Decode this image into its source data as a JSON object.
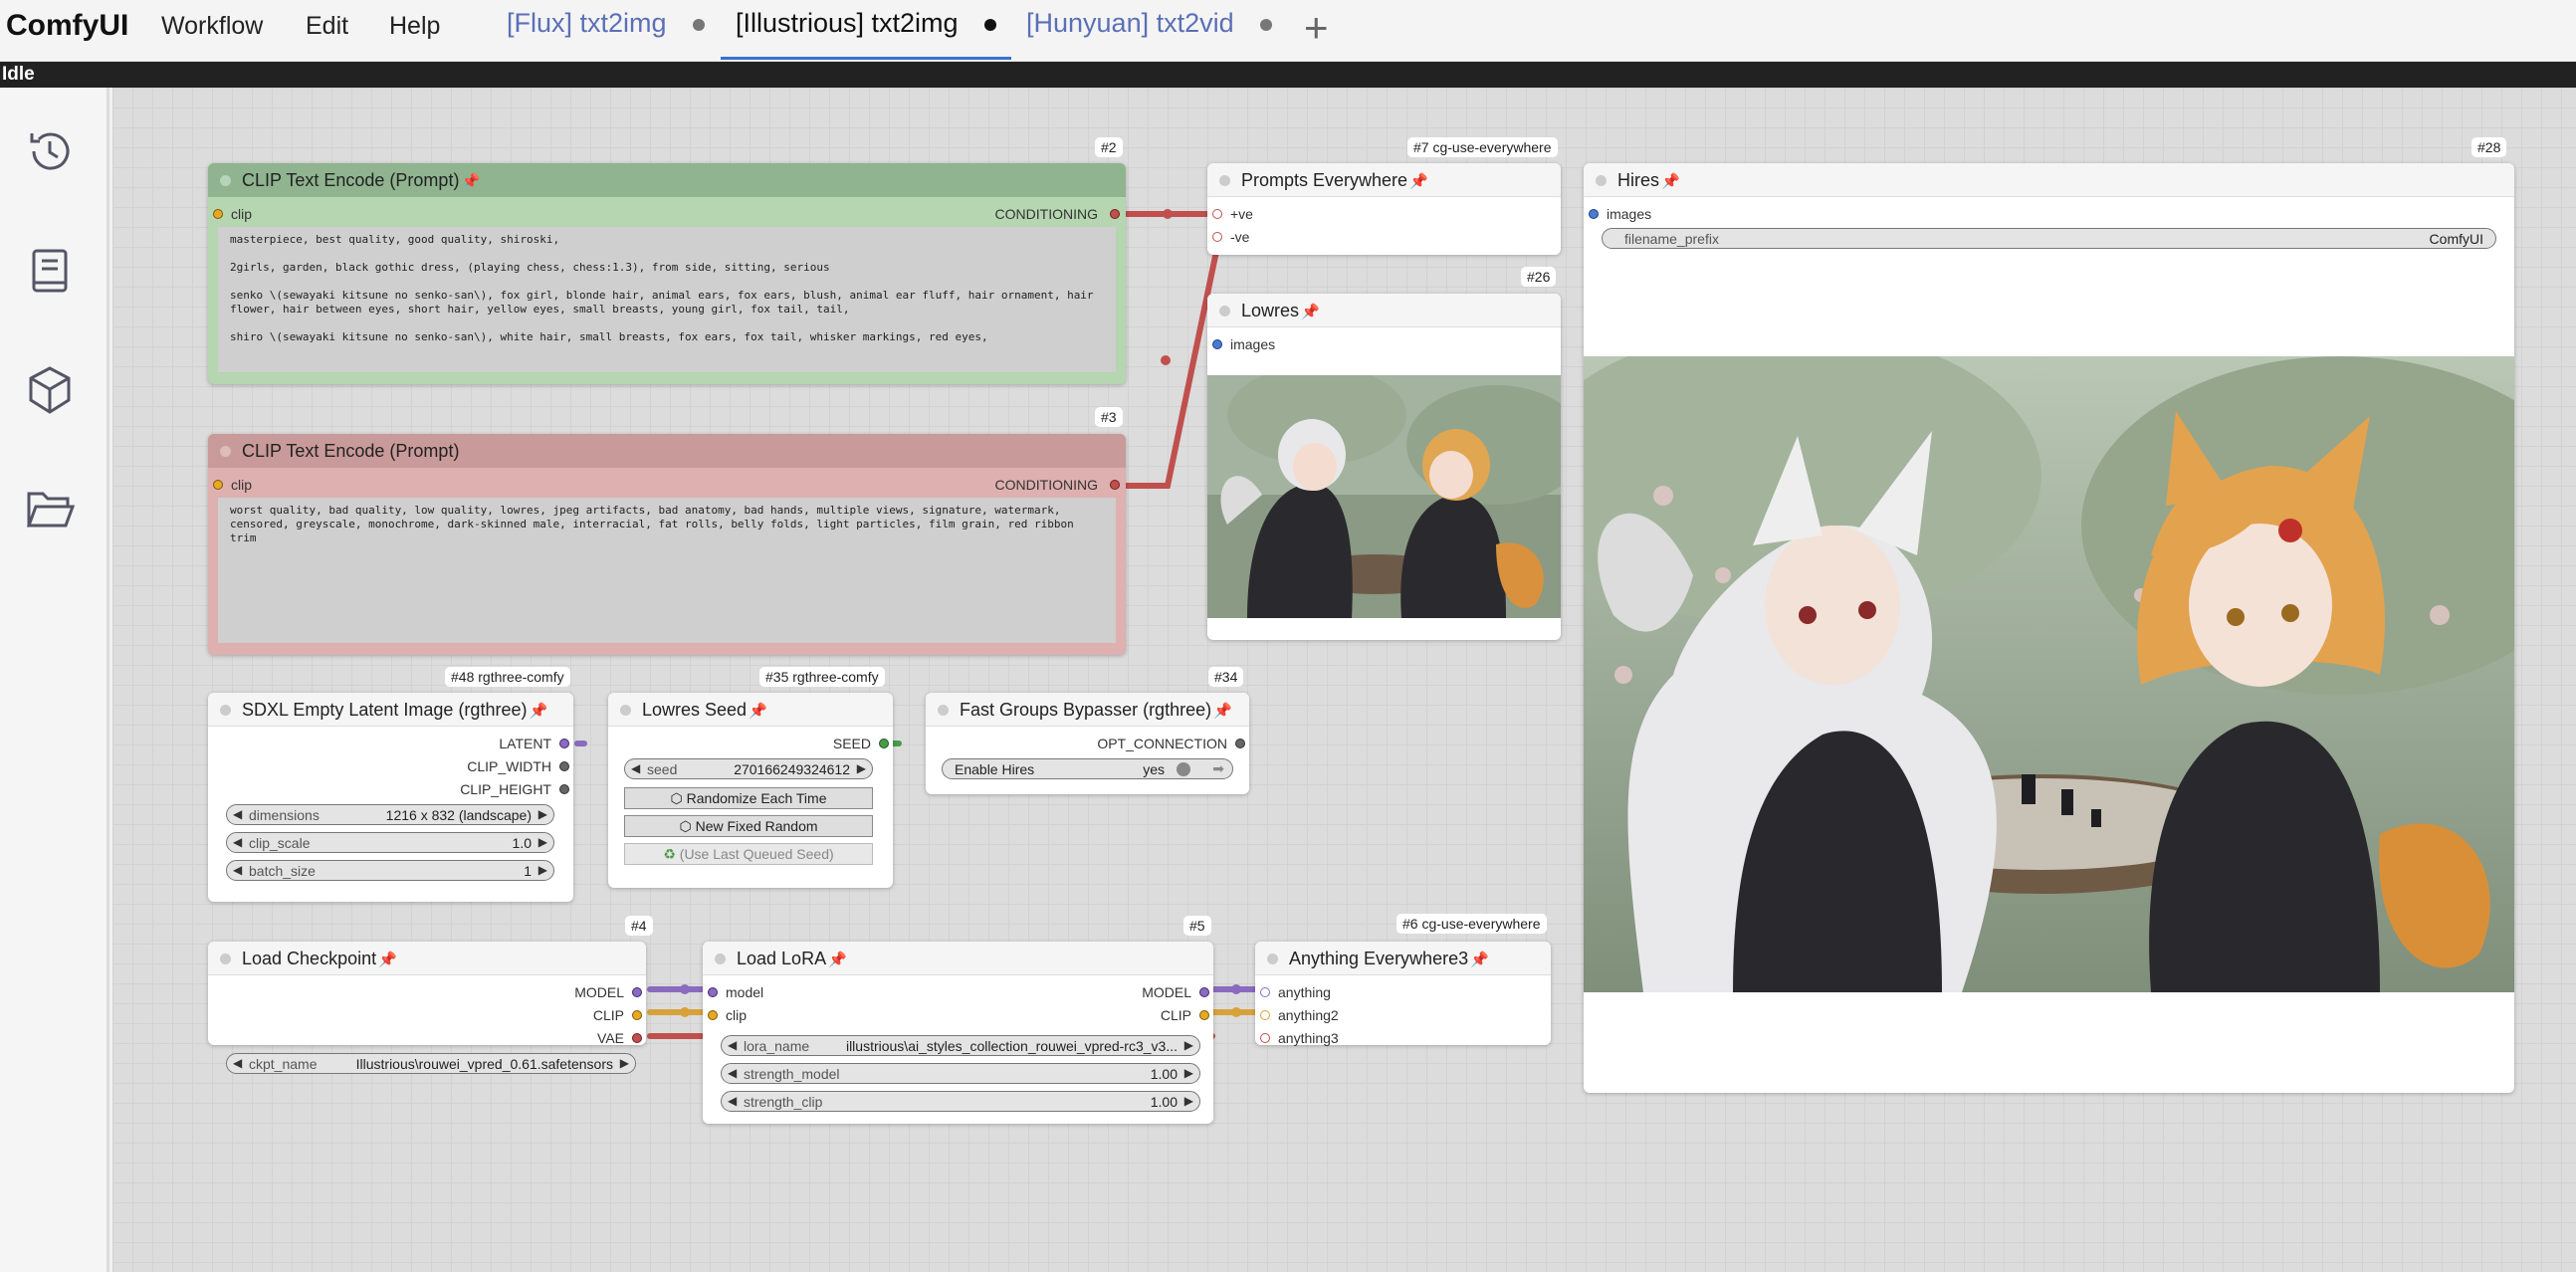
{
  "app": {
    "logo": "ComfyUI",
    "menu": [
      "Workflow",
      "Edit",
      "Help"
    ],
    "tabs": [
      {
        "label": "[Flux] txt2img",
        "active": false
      },
      {
        "label": "[Illustrious] txt2img",
        "active": true
      },
      {
        "label": "[Hunyuan] txt2vid",
        "active": false
      }
    ],
    "add_tab": "+",
    "status": "Idle"
  },
  "sidebar": {
    "icons": [
      "history-icon",
      "book-icon",
      "cube-icon",
      "folder-open-icon"
    ]
  },
  "nodes": {
    "clip_pos": {
      "badge": "#2",
      "title": "CLIP Text Encode (Prompt)",
      "input": "clip",
      "output": "CONDITIONING",
      "text": "masterpiece, best quality, good quality, shiroski,\n\n2girls, garden, black gothic dress, (playing chess, chess:1.3), from side, sitting, serious\n\nsenko \\(sewayaki kitsune no senko-san\\), fox girl, blonde hair, animal ears, fox ears, blush, animal ear fluff, hair ornament, hair flower, hair between eyes, short hair, yellow eyes, small breasts, young girl, fox tail, tail,\n\nshiro \\(sewayaki kitsune no senko-san\\), white hair, small breasts, fox ears, fox tail, whisker markings, red eyes,"
    },
    "clip_neg": {
      "badge": "#3",
      "title": "CLIP Text Encode (Prompt)",
      "input": "clip",
      "output": "CONDITIONING",
      "text": "worst quality, bad quality, low quality, lowres, jpeg artifacts, bad anatomy, bad hands, multiple views, signature, watermark, censored, greyscale, monochrome, dark-skinned male, interracial, fat rolls, belly folds, light particles, film grain, red ribbon trim"
    },
    "prompts_everywhere": {
      "badge": "#7 cg-use-everywhere",
      "title": "Prompts Everywhere",
      "inputs": [
        "+ve",
        "-ve"
      ]
    },
    "lowres": {
      "badge": "#26",
      "title": "Lowres",
      "input": "images"
    },
    "hires": {
      "badge": "#28",
      "title": "Hires",
      "input": "images",
      "widget_label": "filename_prefix",
      "widget_value": "ComfyUI"
    },
    "sdxl_latent": {
      "badge": "#48 rgthree-comfy",
      "title": "SDXL Empty Latent Image (rgthree)",
      "outputs": [
        "LATENT",
        "CLIP_WIDTH",
        "CLIP_HEIGHT"
      ],
      "widgets": [
        {
          "label": "dimensions",
          "value": "1216 x 832   (landscape)"
        },
        {
          "label": "clip_scale",
          "value": "1.0"
        },
        {
          "label": "batch_size",
          "value": "1"
        }
      ]
    },
    "lowres_seed": {
      "badge": "#35 rgthree-comfy",
      "title": "Lowres Seed",
      "output": "SEED",
      "seed_label": "seed",
      "seed_value": "270166249324612",
      "btn_randomize": "Randomize Each Time",
      "btn_fixed": "New Fixed Random",
      "btn_last": "(Use Last Queued Seed)"
    },
    "fast_groups": {
      "badge": "#34",
      "title": "Fast Groups Bypasser (rgthree)",
      "output": "OPT_CONNECTION",
      "toggle_label": "Enable Hires",
      "toggle_value": "yes"
    },
    "load_checkpoint": {
      "badge": "#4",
      "title": "Load Checkpoint",
      "outputs": [
        "MODEL",
        "CLIP",
        "VAE"
      ],
      "widget_label": "ckpt_name",
      "widget_value": "Illustrious\\rouwei_vpred_0.61.safetensors"
    },
    "load_lora": {
      "badge": "#5",
      "title": "Load LoRA",
      "inputs": [
        "model",
        "clip"
      ],
      "outputs": [
        "MODEL",
        "CLIP"
      ],
      "widgets": [
        {
          "label": "lora_name",
          "value": "illustrious\\ai_styles_collection_rouwei_vpred-rc3_v3..."
        },
        {
          "label": "strength_model",
          "value": "1.00"
        },
        {
          "label": "strength_clip",
          "value": "1.00"
        }
      ]
    },
    "anything_everywhere": {
      "badge": "#6 cg-use-everywhere",
      "title": "Anything Everywhere3",
      "inputs": [
        "anything",
        "anything2",
        "anything3"
      ]
    }
  },
  "colors": {
    "green_title": "#8fb48f",
    "green_body": "#b5d6b0",
    "red_title": "#c99a9a",
    "red_body": "#deb0b0",
    "link_red": "#c0504d",
    "link_purple": "#8a6bbf",
    "link_yellow": "#d8a23a",
    "tab_active_underline": "#3b6fd6"
  }
}
